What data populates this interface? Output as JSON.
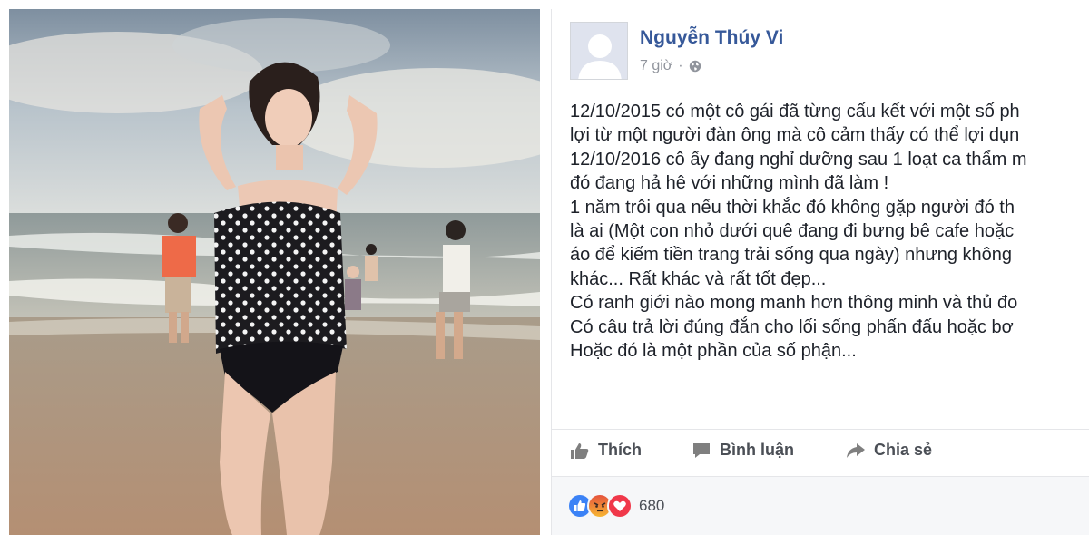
{
  "post": {
    "author": "Nguyễn Thúy Vi",
    "time": "7 giờ",
    "separator": "·",
    "privacy_icon": "globe-icon",
    "lines": [
      "12/10/2015 có một cô gái đã từng cấu kết với một số ph",
      "lợi từ một người đàn ông mà cô cảm thấy có thể lợi dụn",
      "12/10/2016 cô ấy đang nghỉ dưỡng sau 1 loạt ca thẩm m",
      "đó đang hả hê với những mình đã làm !",
      "1 năm trôi qua nếu thời khắc đó không gặp người đó th",
      "là ai (Một con nhỏ dưới quê đang đi bưng bê cafe hoặc",
      "áo để kiếm tiền trang trải sống qua ngày) nhưng không",
      "khác... Rất khác và rất tốt đẹp...",
      "Có ranh giới nào mong manh hơn thông minh và thủ đo",
      "Có câu trả lời đúng đắn cho lối sống phấn đấu hoặc bơ",
      "Hoặc đó là một phần của số phận..."
    ]
  },
  "actions": {
    "like": {
      "label": "Thích",
      "icon": "thumbs-up-icon"
    },
    "comment": {
      "label": "Bình luận",
      "icon": "comment-icon"
    },
    "share": {
      "label": "Chia sẻ",
      "icon": "share-icon"
    }
  },
  "reactions": {
    "types": [
      "like",
      "angry",
      "love"
    ],
    "count": "680"
  },
  "colors": {
    "author": "#365899",
    "like_reaction": "#3b82f6",
    "angry_reaction": "#f59e0b",
    "love_reaction": "#f0384a"
  }
}
